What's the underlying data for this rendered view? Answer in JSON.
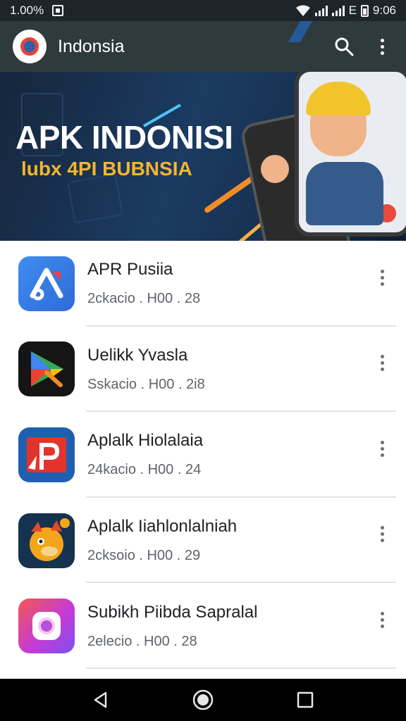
{
  "status_bar": {
    "battery_percent": "1.00%",
    "time": "9:06",
    "network_label": "E"
  },
  "app_bar": {
    "title": "Indonsia",
    "icons": [
      "search-icon",
      "more-vert-icon"
    ]
  },
  "banner": {
    "title": "APK INDONISI",
    "subtitle": "lubx 4PI BUBNSIA"
  },
  "apps": [
    {
      "name": "APR Pusiia",
      "meta": "2ckacio . H00 . 28",
      "icon": "apk-icon"
    },
    {
      "name": "Uelikk Yvasla",
      "meta": "Sskacio . H00 . 2i8",
      "icon": "play-store-icon"
    },
    {
      "name": "Aplalk Hiolalaia",
      "meta": "24kacio . H00 . 24",
      "icon": "p-letter-icon"
    },
    {
      "name": "Aplalk Iiahlonlalniah",
      "meta": "2cksoio . H00 . 29",
      "icon": "mascot-icon"
    },
    {
      "name": "Subikh Piibda Sapralal",
      "meta": "2elecio . H00 . 28",
      "icon": "camera-icon"
    }
  ],
  "colors": {
    "status_bar_bg": "#1e2528",
    "app_bar_bg": "#2f3a3d",
    "banner_accent": "#f5b530",
    "text_primary": "#202124",
    "text_secondary": "#5f6368"
  }
}
